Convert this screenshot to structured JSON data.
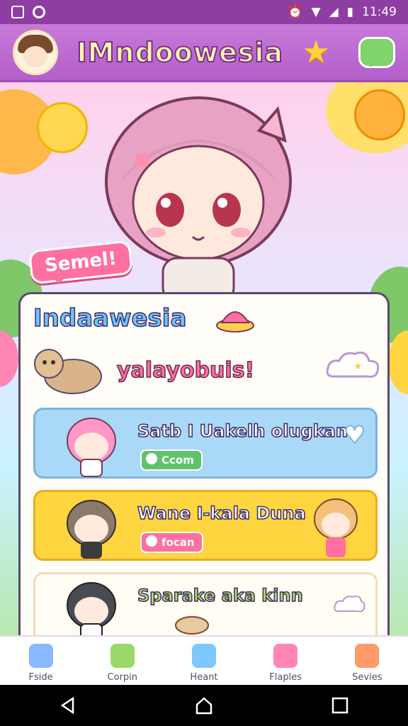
{
  "status_bar": {
    "time": "11:49"
  },
  "header": {
    "title": "IMndoowesia"
  },
  "scene": {
    "speech_bubble": "Semel!"
  },
  "card": {
    "title": "Indaawesia",
    "greeting": "yalayobuis!",
    "rows": [
      {
        "title": "Satb I Uakelh olugkan",
        "tag": "Ccom",
        "style": "blue"
      },
      {
        "title": "Wane I-kala Duna",
        "tag": "focan",
        "style": "yellow"
      },
      {
        "title": "Sparake aka kinn",
        "tag": "",
        "style": "white"
      }
    ]
  },
  "tabs": [
    {
      "label": "Fside",
      "color": "#8ab8ff"
    },
    {
      "label": "Corpin",
      "color": "#9bd86a"
    },
    {
      "label": "Heant",
      "color": "#7dc8ff"
    },
    {
      "label": "Flaples",
      "color": "#ff86b4"
    },
    {
      "label": "Sevies",
      "color": "#ff9a6b"
    }
  ],
  "colors": {
    "status_bar": "#8e3ea3",
    "header": "#b35fcb",
    "accent_pink": "#ff6f9f"
  }
}
